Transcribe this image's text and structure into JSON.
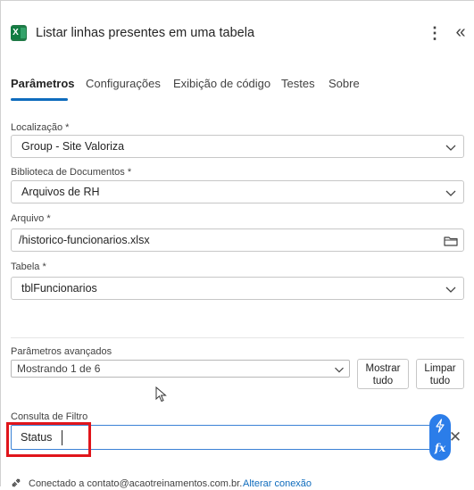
{
  "header": {
    "title": "Listar linhas presentes em uma tabela",
    "icon": "excel-icon"
  },
  "tabs": [
    {
      "label": "Parâmetros",
      "active": true
    },
    {
      "label": "Configurações",
      "active": false
    },
    {
      "label": "Exibição de código",
      "active": false
    },
    {
      "label": "Testes",
      "active": false
    },
    {
      "label": "Sobre",
      "active": false
    }
  ],
  "fields": {
    "localizacao": {
      "label": "Localização *",
      "value": "Group - Site Valoriza"
    },
    "biblioteca": {
      "label": "Biblioteca de Documentos *",
      "value": "Arquivos de RH"
    },
    "arquivo": {
      "label": "Arquivo *",
      "value": "/historico-funcionarios.xlsx"
    },
    "tabela": {
      "label": "Tabela *",
      "value": "tblFuncionarios"
    }
  },
  "advanced": {
    "label": "Parâmetros avançados",
    "value": "Mostrando 1 de 6",
    "show_all": "Mostrar\ntudo",
    "clear_all": "Limpar\ntudo"
  },
  "filter": {
    "label": "Consulta de Filtro",
    "value": "Status"
  },
  "connection": {
    "text": "Conectado a contato@acaotreinamentos.com.br.",
    "link": "Alterar conexão"
  },
  "colors": {
    "accent": "#0f6cbd",
    "highlight": "#e0151b",
    "excel": "#107c41",
    "pill": "#2b7de9"
  }
}
